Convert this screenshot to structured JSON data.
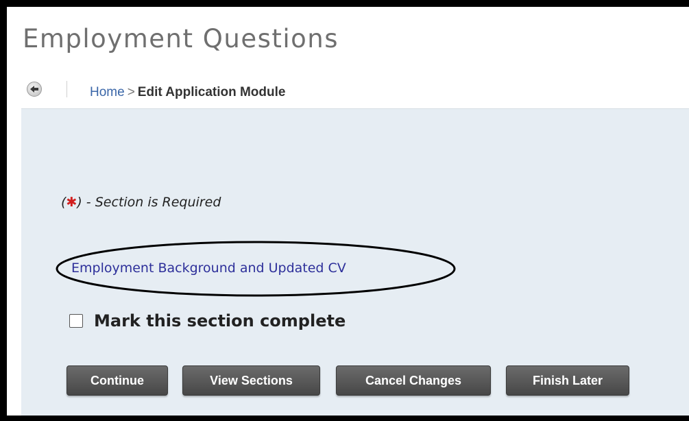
{
  "page": {
    "title": "Employment Questions"
  },
  "breadcrumb": {
    "home": "Home",
    "separator": ">",
    "current": "Edit Application Module"
  },
  "nav": {
    "back_icon": "back-arrow-icon"
  },
  "form": {
    "required_open": "(",
    "required_star": "✱",
    "required_note": ") - Section is Required",
    "section_link": "Employment Background and Updated CV",
    "complete_checkbox_label": "Mark this section complete",
    "complete_checked": false
  },
  "buttons": {
    "continue": "Continue",
    "view_sections": "View Sections",
    "cancel_changes": "Cancel Changes",
    "finish_later": "Finish Later"
  },
  "colors": {
    "panel_background": "#e6edf3",
    "link": "#2d2f9a",
    "required_star": "#d21f1f",
    "button": "#5a5a5a"
  }
}
